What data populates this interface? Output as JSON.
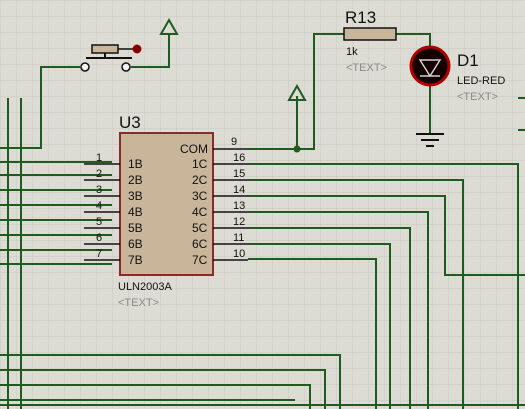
{
  "colors": {
    "background": "#dcdcd4",
    "grid": "#c7c7bf",
    "wire": "#1f5a1f",
    "body_fill": "#c9b69a",
    "body_stroke": "#8a2a2a",
    "text": "#111111",
    "muted": "#8a8a8a",
    "led_red": "#b00000",
    "led_dark": "#140000",
    "junction": "#1f5a1f"
  },
  "switch": {
    "name": "push-button-switch"
  },
  "resistor": {
    "ref": "R13",
    "value": "1k",
    "placeholder": "<TEXT>"
  },
  "led": {
    "ref": "D1",
    "type": "LED-RED",
    "placeholder": "<TEXT>"
  },
  "ic": {
    "ref": "U3",
    "part": "ULN2003A",
    "placeholder": "<TEXT>",
    "com_label": "COM",
    "com_pin": "9",
    "inputs": [
      {
        "pin": "1",
        "label": "1B"
      },
      {
        "pin": "2",
        "label": "2B"
      },
      {
        "pin": "3",
        "label": "3B"
      },
      {
        "pin": "4",
        "label": "4B"
      },
      {
        "pin": "5",
        "label": "5B"
      },
      {
        "pin": "6",
        "label": "6B"
      },
      {
        "pin": "7",
        "label": "7B"
      }
    ],
    "outputs": [
      {
        "pin": "16",
        "label": "1C"
      },
      {
        "pin": "15",
        "label": "2C"
      },
      {
        "pin": "14",
        "label": "3C"
      },
      {
        "pin": "13",
        "label": "4C"
      },
      {
        "pin": "12",
        "label": "5C"
      },
      {
        "pin": "11",
        "label": "6C"
      },
      {
        "pin": "10",
        "label": "7C"
      }
    ]
  }
}
